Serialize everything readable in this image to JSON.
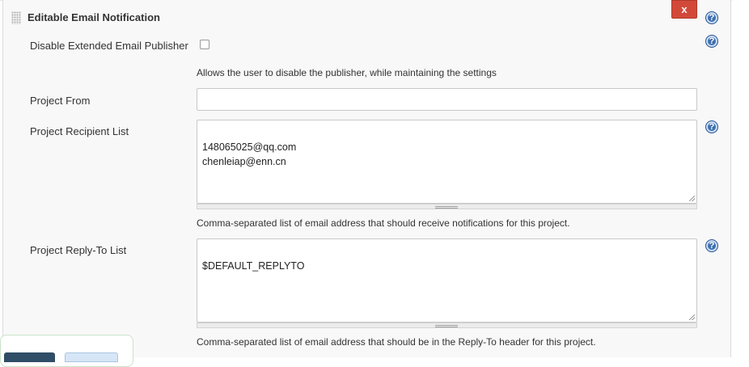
{
  "section": {
    "title": "Editable Email Notification",
    "close_label": "x"
  },
  "help_label": "?",
  "fields": {
    "disable_publisher": {
      "label": "Disable Extended Email Publisher",
      "checked": false,
      "description": "Allows the user to disable the publisher, while maintaining the settings"
    },
    "project_from": {
      "label": "Project From",
      "value": ""
    },
    "recipient_list": {
      "label": "Project Recipient List",
      "value": "148065025@qq.com\nchenleiap@enn.cn",
      "description": "Comma-separated list of email address that should receive notifications for this project."
    },
    "reply_to_list": {
      "label": "Project Reply-To List",
      "value": "$DEFAULT_REPLYTO",
      "description": "Comma-separated list of email address that should be in the Reply-To header for this project."
    }
  },
  "colors": {
    "close_button": "#d24939",
    "help_icon": "#3d6fb0",
    "panel_background": "#f8f8f8"
  }
}
